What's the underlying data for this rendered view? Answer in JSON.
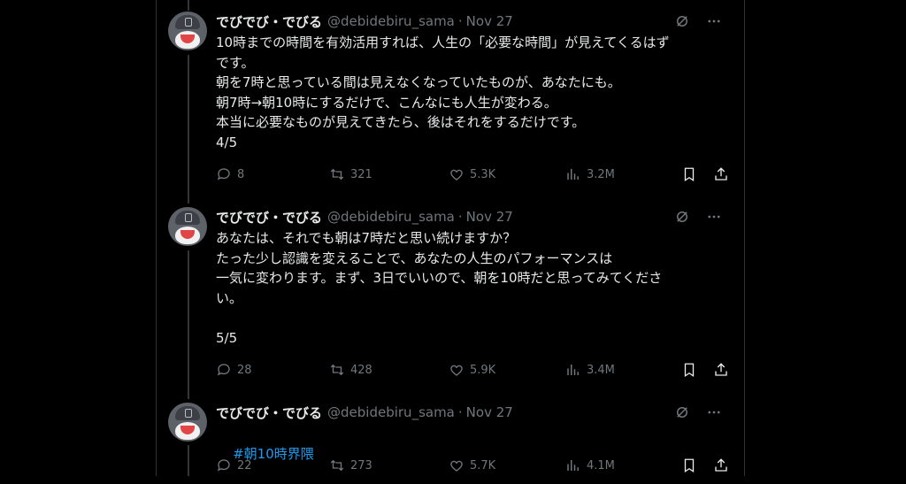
{
  "tweets": [
    {
      "name": "でびでび・でびる",
      "handle": "@debidebiru_sama",
      "date": "Nov 27",
      "text": "10時までの時間を有効活用すれば、人生の「必要な時間」が見えてくるはず\nです。\n朝を7時と思っている間は見えなくなっていたものが、あなたにも。\n朝7時→朝10時にするだけで、こんなにも人生が変わる。\n本当に必要なものが見えてきたら、後はそれをするだけです。\n4/5",
      "replies": "8",
      "reposts": "321",
      "likes": "5.3K",
      "views": "3.2M"
    },
    {
      "name": "でびでび・でびる",
      "handle": "@debidebiru_sama",
      "date": "Nov 27",
      "text": "あなたは、それでも朝は7時だと思い続けますか？\nたった少し認識を変えることで、あなたの人生のパフォーマンスは\n一気に変わります。まず、3日でいいので、朝を10時だと思ってみてくださ\nい。\n\n5/5",
      "replies": "28",
      "reposts": "428",
      "likes": "5.9K",
      "views": "3.4M"
    },
    {
      "name": "でびでび・でびる",
      "handle": "@debidebiru_sama",
      "date": "Nov 27",
      "hashtag": "#朝10時界隈",
      "replies": "22",
      "reposts": "273",
      "likes": "5.7K",
      "views": "4.1M"
    }
  ],
  "icons": {
    "grok": "grok-icon",
    "more": "more-icon",
    "reply": "reply-icon",
    "repost": "repost-icon",
    "like": "like-icon",
    "views": "views-icon",
    "bookmark": "bookmark-icon",
    "share": "share-icon"
  },
  "colors": {
    "background": "#000000",
    "text": "#e7e9ea",
    "muted": "#71767b",
    "link": "#1d9bf0",
    "border": "#2f3336"
  }
}
